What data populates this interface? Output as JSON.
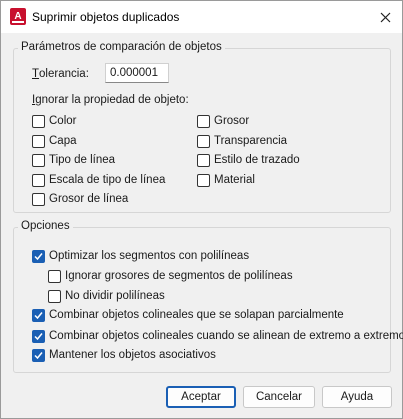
{
  "window": {
    "title": "Suprimir objetos duplicados",
    "app_icon_letter": "A"
  },
  "comparison": {
    "group_label": "Parámetros de comparación de objetos",
    "tolerance_label": "Tolerancia:",
    "tolerance_value": "0.000001",
    "ignore_label": "Ignorar la propiedad de objeto:",
    "left_options": [
      {
        "label": "Color",
        "checked": false
      },
      {
        "label": "Capa",
        "checked": false
      },
      {
        "label": "Tipo de línea",
        "checked": false
      },
      {
        "label": "Escala de tipo de línea",
        "checked": false
      },
      {
        "label": "Grosor de línea",
        "checked": false
      }
    ],
    "right_options": [
      {
        "label": "Grosor",
        "checked": false
      },
      {
        "label": "Transparencia",
        "checked": false
      },
      {
        "label": "Estilo de trazado",
        "checked": false
      },
      {
        "label": "Material",
        "checked": false
      }
    ]
  },
  "options": {
    "group_label": "Opciones",
    "optimize": {
      "label": "Optimizar los segmentos con polilíneas",
      "checked": true
    },
    "ignore_widths": {
      "label": "Ignorar grosores de segmentos de polilíneas",
      "checked": false
    },
    "no_break": {
      "label": "No dividir polilíneas",
      "checked": false
    },
    "combine_overlap": {
      "label": "Combinar objetos colineales que se solapan parcialmente",
      "checked": true
    },
    "combine_end": {
      "label": "Combinar objetos colineales cuando se alinean de extremo a extremo",
      "checked": true
    },
    "keep_assoc": {
      "label": "Mantener los objetos asociativos",
      "checked": true
    }
  },
  "buttons": {
    "ok": "Aceptar",
    "cancel": "Cancelar",
    "help": "Ayuda"
  },
  "colors": {
    "accent": "#1a5fb4",
    "app_icon": "#c8102e"
  }
}
